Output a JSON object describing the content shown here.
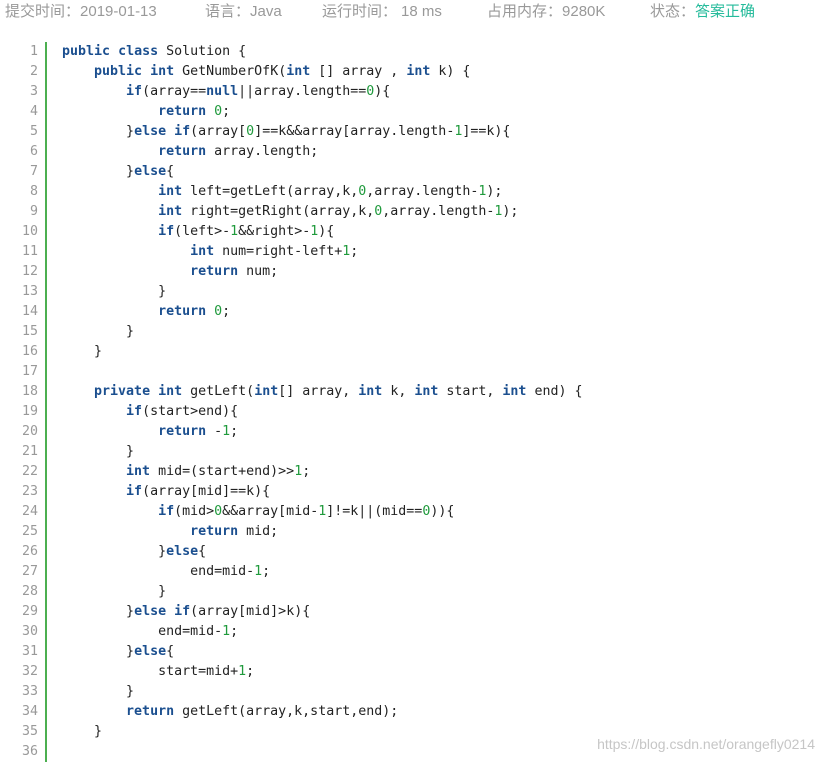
{
  "submission": {
    "time": {
      "label": "提交时间：",
      "value": "2019-01-13"
    },
    "language": {
      "label": "语言：",
      "value": "Java"
    },
    "runtime": {
      "label": "运行时间：",
      "value": "18 ms"
    },
    "memory": {
      "label": "占用内存：",
      "value": "9280K"
    },
    "status": {
      "label": "状态：",
      "value": "答案正确"
    }
  },
  "colors": {
    "accent": "#25bb9b",
    "meta_text": "#999999",
    "keyword": "#1b4f8f",
    "number": "#1f9a3c",
    "code_text": "#222222",
    "line_number": "#999999",
    "gutter": "#4caf50",
    "watermark": "#c6c6c6"
  },
  "code": {
    "lines": [
      {
        "num": 1,
        "text": "public class Solution {"
      },
      {
        "num": 2,
        "text": "    public int GetNumberOfK(int [] array , int k) {"
      },
      {
        "num": 3,
        "text": "        if(array==null||array.length==0){"
      },
      {
        "num": 4,
        "text": "            return 0;"
      },
      {
        "num": 5,
        "text": "        }else if(array[0]==k&&array[array.length-1]==k){"
      },
      {
        "num": 6,
        "text": "            return array.length;"
      },
      {
        "num": 7,
        "text": "        }else{"
      },
      {
        "num": 8,
        "text": "            int left=getLeft(array,k,0,array.length-1);"
      },
      {
        "num": 9,
        "text": "            int right=getRight(array,k,0,array.length-1);"
      },
      {
        "num": 10,
        "text": "            if(left>-1&&right>-1){"
      },
      {
        "num": 11,
        "text": "                int num=right-left+1;"
      },
      {
        "num": 12,
        "text": "                return num;"
      },
      {
        "num": 13,
        "text": "            }"
      },
      {
        "num": 14,
        "text": "            return 0;"
      },
      {
        "num": 15,
        "text": "        }"
      },
      {
        "num": 16,
        "text": "    }"
      },
      {
        "num": 17,
        "text": ""
      },
      {
        "num": 18,
        "text": "    private int getLeft(int[] array, int k, int start, int end) {"
      },
      {
        "num": 19,
        "text": "        if(start>end){"
      },
      {
        "num": 20,
        "text": "            return -1;"
      },
      {
        "num": 21,
        "text": "        }"
      },
      {
        "num": 22,
        "text": "        int mid=(start+end)>>1;"
      },
      {
        "num": 23,
        "text": "        if(array[mid]==k){"
      },
      {
        "num": 24,
        "text": "            if(mid>0&&array[mid-1]!=k||(mid==0)){"
      },
      {
        "num": 25,
        "text": "                return mid;"
      },
      {
        "num": 26,
        "text": "            }else{"
      },
      {
        "num": 27,
        "text": "                end=mid-1;"
      },
      {
        "num": 28,
        "text": "            }"
      },
      {
        "num": 29,
        "text": "        }else if(array[mid]>k){"
      },
      {
        "num": 30,
        "text": "            end=mid-1;"
      },
      {
        "num": 31,
        "text": "        }else{"
      },
      {
        "num": 32,
        "text": "            start=mid+1;"
      },
      {
        "num": 33,
        "text": "        }"
      },
      {
        "num": 34,
        "text": "        return getLeft(array,k,start,end);"
      },
      {
        "num": 35,
        "text": "    }"
      },
      {
        "num": 36,
        "text": ""
      }
    ]
  },
  "watermark": "https://blog.csdn.net/orangefly0214"
}
